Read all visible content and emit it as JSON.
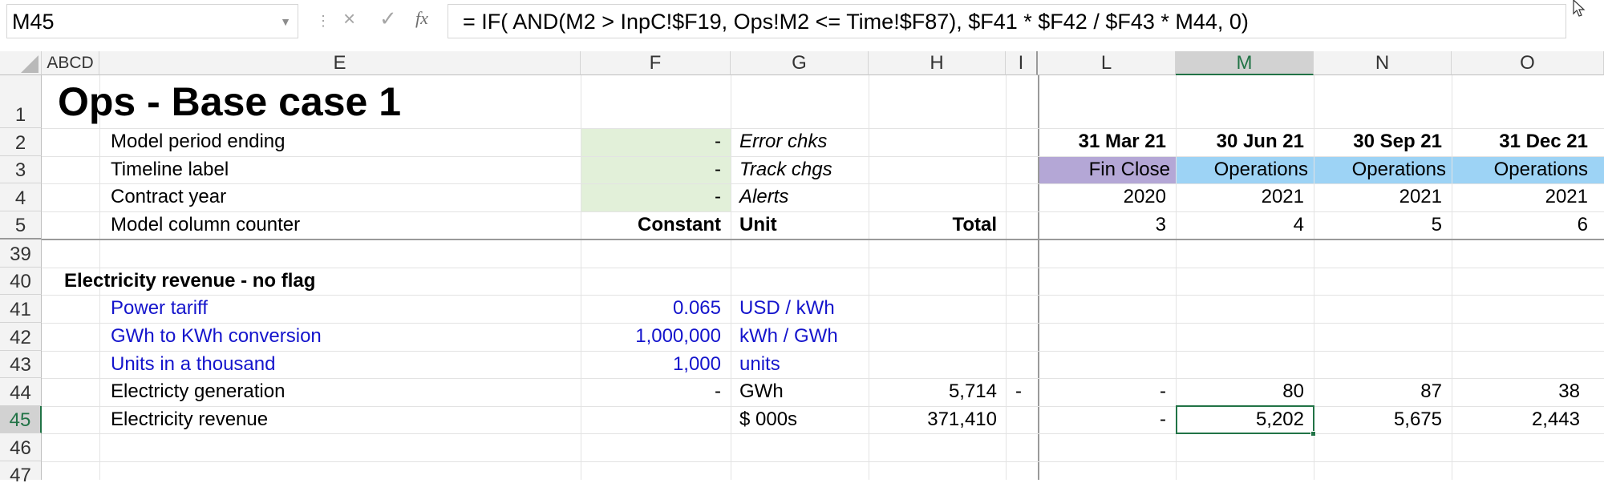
{
  "formula_bar": {
    "name_box": "M45",
    "cancel_icon": "×",
    "enter_icon": "✓",
    "fx_label": "fx",
    "formula": "= IF( AND(M2 > InpC!$F19, Ops!M2 <= Time!$F87), $F41 * $F42 / $F43 * M44, 0)"
  },
  "columns": [
    "ABCD",
    "E",
    "F",
    "G",
    "H",
    "I",
    "L",
    "M",
    "N",
    "O"
  ],
  "rows": [
    "1",
    "2",
    "3",
    "4",
    "5",
    "39",
    "40",
    "41",
    "42",
    "43",
    "44",
    "45",
    "46",
    "47"
  ],
  "sheet": {
    "title": "Ops - Base case 1",
    "header_rows": [
      {
        "label": "Model period ending",
        "f": "-",
        "g": "Error chks",
        "h": "",
        "l": "31 Mar 21",
        "m": "30 Jun 21",
        "n": "30 Sep 21",
        "o": "31 Dec 21"
      },
      {
        "label": "Timeline label",
        "f": "-",
        "g": "Track chgs",
        "h": "",
        "l": "Fin Close",
        "m": "Operations",
        "n": "Operations",
        "o": "Operations"
      },
      {
        "label": "Contract year",
        "f": "-",
        "g": "Alerts",
        "h": "",
        "l": "2020",
        "m": "2021",
        "n": "2021",
        "o": "2021"
      },
      {
        "label": "Model column counter",
        "f": "Constant",
        "g": "Unit",
        "h": "Total",
        "l": "3",
        "m": "4",
        "n": "5",
        "o": "6"
      }
    ],
    "section_title": "Electricity revenue - no flag",
    "data_rows": [
      {
        "label": "Power tariff",
        "f": "0.065",
        "g": "USD / kWh",
        "h": "",
        "i": "",
        "l": "",
        "m": "",
        "n": "",
        "o": ""
      },
      {
        "label": "GWh to KWh conversion",
        "f": "1,000,000",
        "g": "kWh / GWh",
        "h": "",
        "i": "",
        "l": "",
        "m": "",
        "n": "",
        "o": ""
      },
      {
        "label": "Units in a thousand",
        "f": "1,000",
        "g": "units",
        "h": "",
        "i": "",
        "l": "",
        "m": "",
        "n": "",
        "o": ""
      },
      {
        "label": "Electricty generation",
        "f": "-",
        "g": "GWh",
        "h": "5,714",
        "i": "-",
        "l": "-",
        "m": "80",
        "n": "87",
        "o": "38"
      },
      {
        "label": "Electricity revenue",
        "f": "",
        "g": "$ 000s",
        "h": "371,410",
        "i": "",
        "l": "-",
        "m": "5,202",
        "n": "5,675",
        "o": "2,443"
      }
    ]
  },
  "colors": {
    "input_blue": "#1414cc",
    "selection_green": "#217346",
    "input_fill": "#e2f0d9",
    "fin_close_fill": "#b4a7d6",
    "operations_fill": "#9dd3f5"
  }
}
